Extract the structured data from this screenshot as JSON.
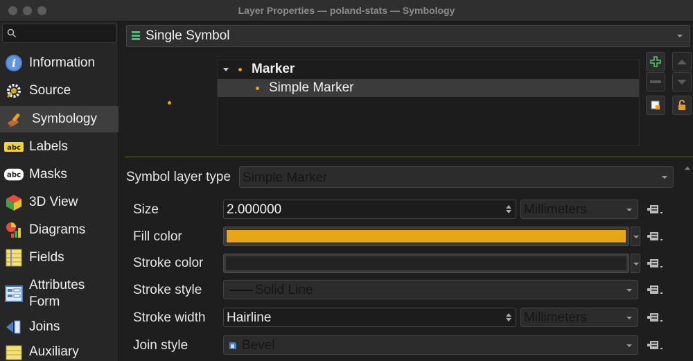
{
  "window": {
    "title": "Layer Properties — poland-stats — Symbology"
  },
  "sidebar": {
    "search_placeholder": "",
    "items": [
      {
        "label": "Information",
        "icon": "info-icon"
      },
      {
        "label": "Source",
        "icon": "source-gear-icon"
      },
      {
        "label": "Symbology",
        "icon": "paintbrush-icon"
      },
      {
        "label": "Labels",
        "icon": "labels-abc-icon"
      },
      {
        "label": "Masks",
        "icon": "masks-abc-icon"
      },
      {
        "label": "3D View",
        "icon": "cube-3d-icon"
      },
      {
        "label": "Diagrams",
        "icon": "diagram-icon"
      },
      {
        "label": "Fields",
        "icon": "fields-icon"
      },
      {
        "label": "Attributes Form",
        "icon": "attributes-form-icon"
      },
      {
        "label": "Joins",
        "icon": "joins-icon"
      },
      {
        "label": "Auxiliary",
        "icon": "auxiliary-icon"
      }
    ],
    "active": "Symbology"
  },
  "renderer": {
    "label": "Single Symbol"
  },
  "symbol_tree": {
    "root": "Marker",
    "child": "Simple Marker"
  },
  "properties": {
    "layer_type_label": "Symbol layer type",
    "layer_type_value": "Simple Marker",
    "size_label": "Size",
    "size_value": "2.000000",
    "size_unit": "Millimeters",
    "fill_label": "Fill color",
    "fill_color": "#e8a612",
    "stroke_color_label": "Stroke color",
    "stroke_color": "#232323",
    "stroke_style_label": "Stroke style",
    "stroke_style_value": "Solid Line",
    "stroke_width_label": "Stroke width",
    "stroke_width_value": "Hairline",
    "stroke_width_unit": "Millimeters",
    "join_style_label": "Join style",
    "join_style_value": "Bevel"
  },
  "colors": {
    "accent": "#e8a317",
    "selection": "#3b3b3b"
  }
}
